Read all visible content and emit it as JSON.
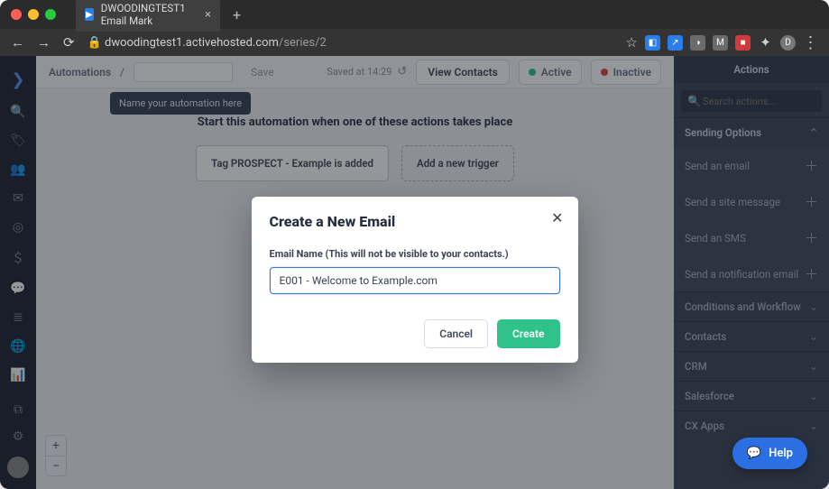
{
  "browser": {
    "tab_title": "DWOODINGTEST1 Email Mark",
    "url_host": "dwoodingtest1.activehosted.com",
    "url_path": "/series/2",
    "avatar_letter": "D"
  },
  "topbar": {
    "crumb": "Automations",
    "separator": "/",
    "name_placeholder": "",
    "save_label": "Save",
    "saved_text": "Saved at 14:29",
    "view_contacts": "View Contacts",
    "active_label": "Active",
    "inactive_label": "Inactive"
  },
  "tooltip": {
    "text": "Name your automation here"
  },
  "canvas": {
    "title": "Start this automation when one of these actions takes place",
    "trigger1": "Tag PROSPECT - Example is added",
    "trigger_add": "Add a new trigger"
  },
  "actions": {
    "header": "Actions",
    "search_placeholder": "Search actions...",
    "sending_options": "Sending Options",
    "items": [
      {
        "label": "Send an email"
      },
      {
        "label": "Send a site message"
      },
      {
        "label": "Send an SMS"
      },
      {
        "label": "Send a notification email"
      }
    ],
    "sections": [
      "Conditions and Workflow",
      "Contacts",
      "CRM",
      "Salesforce",
      "CX Apps"
    ]
  },
  "modal": {
    "title": "Create a New Email",
    "label": "Email Name (This will not be visible to your contacts.)",
    "value": "E001 - Welcome to Example.com",
    "cancel": "Cancel",
    "create": "Create"
  },
  "help": {
    "label": "Help"
  }
}
